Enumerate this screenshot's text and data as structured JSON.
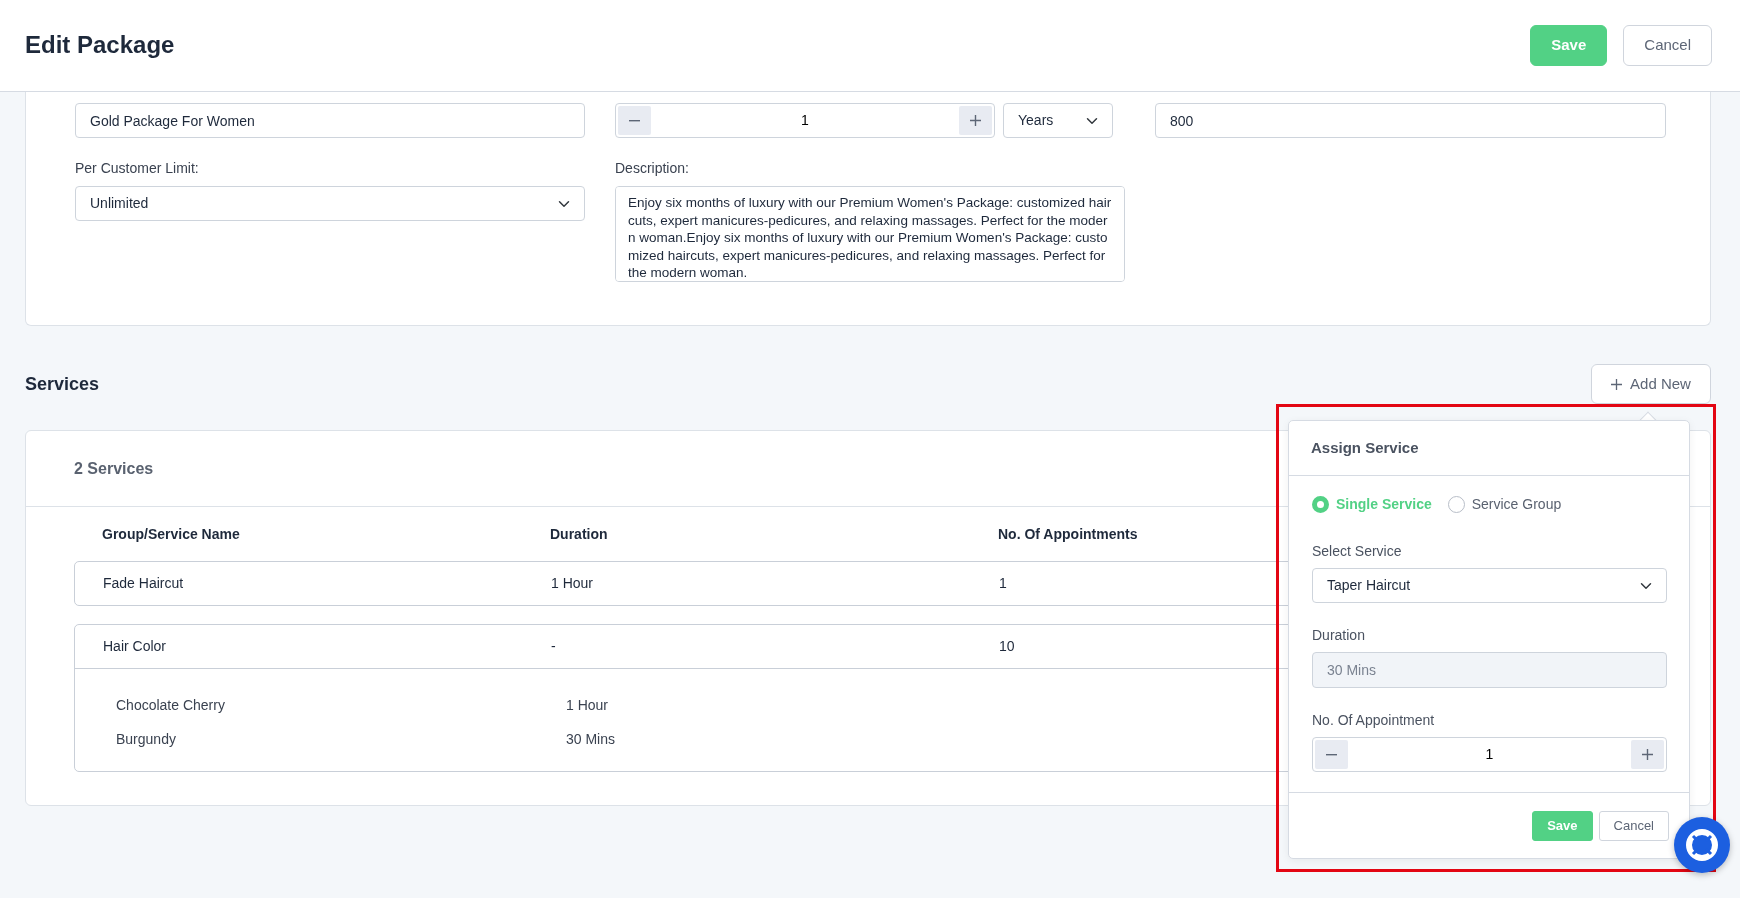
{
  "header": {
    "title": "Edit Package",
    "buttons": [
      {
        "label": "Save",
        "kind": "primary"
      },
      {
        "label": "Cancel",
        "kind": "secondary"
      }
    ]
  },
  "package_form": {
    "package_name": {
      "value": "Gold Package For Women"
    },
    "duration": {
      "value": "1",
      "unit": "Years"
    },
    "price": {
      "value": "800"
    },
    "per_customer_limit": {
      "label": "Per Customer Limit:",
      "value": "Unlimited"
    },
    "description": {
      "label": "Description:",
      "value": "Enjoy six months of luxury with our Premium Women's Package: customized haircuts, expert manicures-pedicures, and relaxing massages. Perfect for the modern woman.Enjoy six months of luxury with our Premium Women's Package: customized haircuts, expert manicures-pedicures, and relaxing massages. Perfect for the modern woman."
    }
  },
  "services": {
    "title": "Services",
    "add_button": "Add New",
    "count_label": "2 Services",
    "columns": [
      "Group/Service Name",
      "Duration",
      "No. Of Appointments"
    ],
    "rows": [
      {
        "name": "Fade Haircut",
        "duration": "1 Hour",
        "appointments": "1"
      },
      {
        "name": "Hair Color",
        "duration": "-",
        "appointments": "10",
        "children": [
          {
            "name": "Chocolate Cherry",
            "duration": "1 Hour"
          },
          {
            "name": "Burgundy",
            "duration": "30 Mins"
          }
        ]
      }
    ]
  },
  "assign_popup": {
    "title": "Assign Service",
    "options": [
      {
        "label": "Single Service",
        "selected": true
      },
      {
        "label": "Service Group",
        "selected": false
      }
    ],
    "select_service": {
      "label": "Select Service",
      "value": "Taper Haircut"
    },
    "duration": {
      "label": "Duration",
      "value": "30 Mins",
      "disabled": true
    },
    "appointments": {
      "label": "No. Of Appointment",
      "value": "1"
    },
    "buttons": [
      {
        "label": "Save",
        "kind": "primary"
      },
      {
        "label": "Cancel",
        "kind": "secondary"
      }
    ]
  }
}
